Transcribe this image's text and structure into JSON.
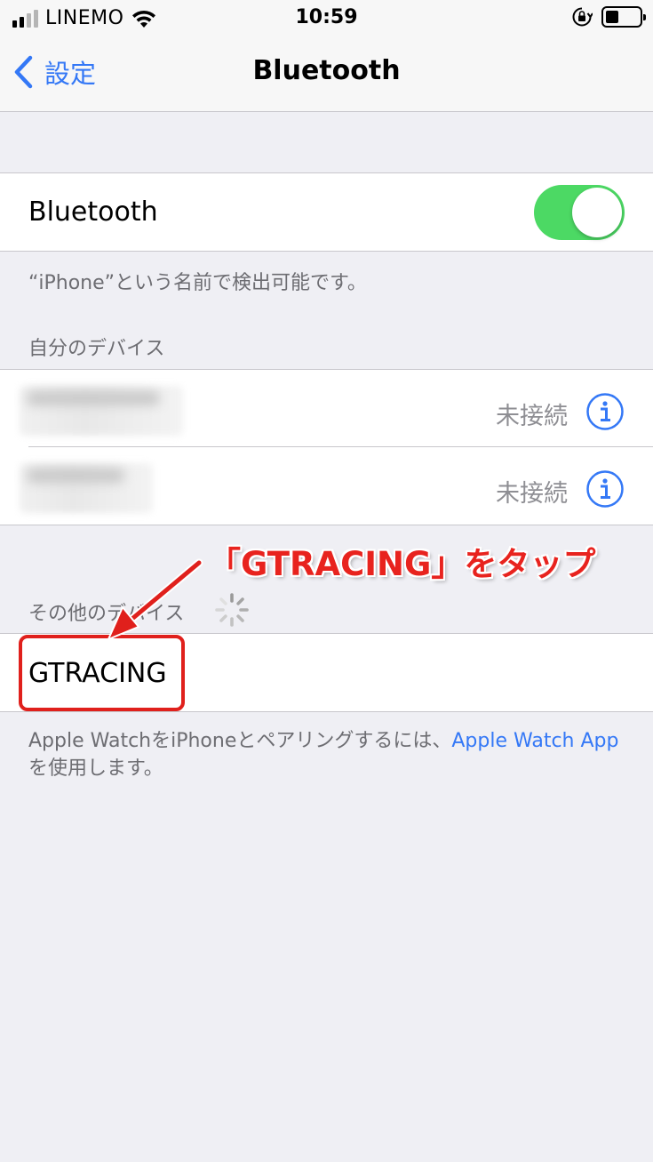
{
  "status_bar": {
    "carrier": "LINEMO",
    "time": "10:59"
  },
  "nav": {
    "back_label": "設定",
    "title": "Bluetooth"
  },
  "bluetooth_toggle": {
    "label": "Bluetooth",
    "on": true,
    "color": "#4cd964"
  },
  "discoverable_text": "“iPhone”という名前で検出可能です。",
  "my_devices": {
    "header": "自分のデバイス",
    "items": [
      {
        "status": "未接続"
      },
      {
        "status": "未接続"
      }
    ]
  },
  "other_devices": {
    "header": "その他のデバイス",
    "items": [
      {
        "name": "GTRACING"
      }
    ]
  },
  "apple_watch_note": {
    "text_before": "Apple WatchをiPhoneとペアリングするには、",
    "link": "Apple Watch App",
    "text_after": "を使用します。"
  },
  "annotation": {
    "text": "「GTRACING」をタップ",
    "color": "#e8231e"
  },
  "colors": {
    "accent": "#3478f6",
    "background": "#efeff4"
  }
}
